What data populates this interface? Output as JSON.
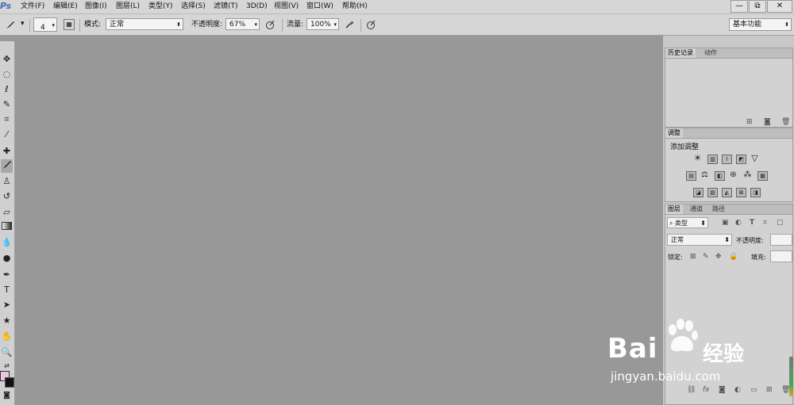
{
  "app": {
    "logo": "Ps"
  },
  "menu": [
    "文件(F)",
    "编辑(E)",
    "图像(I)",
    "图层(L)",
    "类型(Y)",
    "选择(S)",
    "滤镜(T)",
    "3D(D)",
    "视图(V)",
    "窗口(W)",
    "帮助(H)"
  ],
  "window_controls": {
    "minimize": "—",
    "restore": "⧉",
    "close": "✕"
  },
  "options_bar": {
    "brush_size": "4",
    "mode_label": "模式:",
    "mode_value": "正常",
    "opacity_label": "不透明度:",
    "opacity_value": "67%",
    "flow_label": "流量:",
    "flow_value": "100%",
    "workspace": "基本功能"
  },
  "tools": [
    "move-tool",
    "marquee-tool",
    "lasso-tool",
    "quick-select-tool",
    "crop-tool",
    "eyedropper-tool",
    "spot-heal-tool",
    "brush-tool",
    "clone-stamp-tool",
    "history-brush-tool",
    "eraser-tool",
    "gradient-tool",
    "blur-tool",
    "dodge-tool",
    "pen-tool",
    "type-tool",
    "path-select-tool",
    "shape-tool",
    "hand-tool",
    "zoom-tool"
  ],
  "colors": {
    "foreground": "#e8c7dc",
    "background": "#111111",
    "canvas": "#989898"
  },
  "panels": {
    "history": {
      "tabs": [
        "历史记录",
        "动作"
      ]
    },
    "adjustments": {
      "tab": "调整",
      "heading": "添加调整"
    },
    "layers": {
      "tabs": [
        "图层",
        "通道",
        "路径"
      ],
      "filter": "类型",
      "blend_mode": "正常",
      "opacity_label": "不透明度:",
      "lock_label": "锁定:",
      "fill_label": "填充:"
    }
  },
  "watermark": {
    "brand": "Bai",
    "brand_cn": "经验",
    "url": "jingyan.baidu.com"
  }
}
